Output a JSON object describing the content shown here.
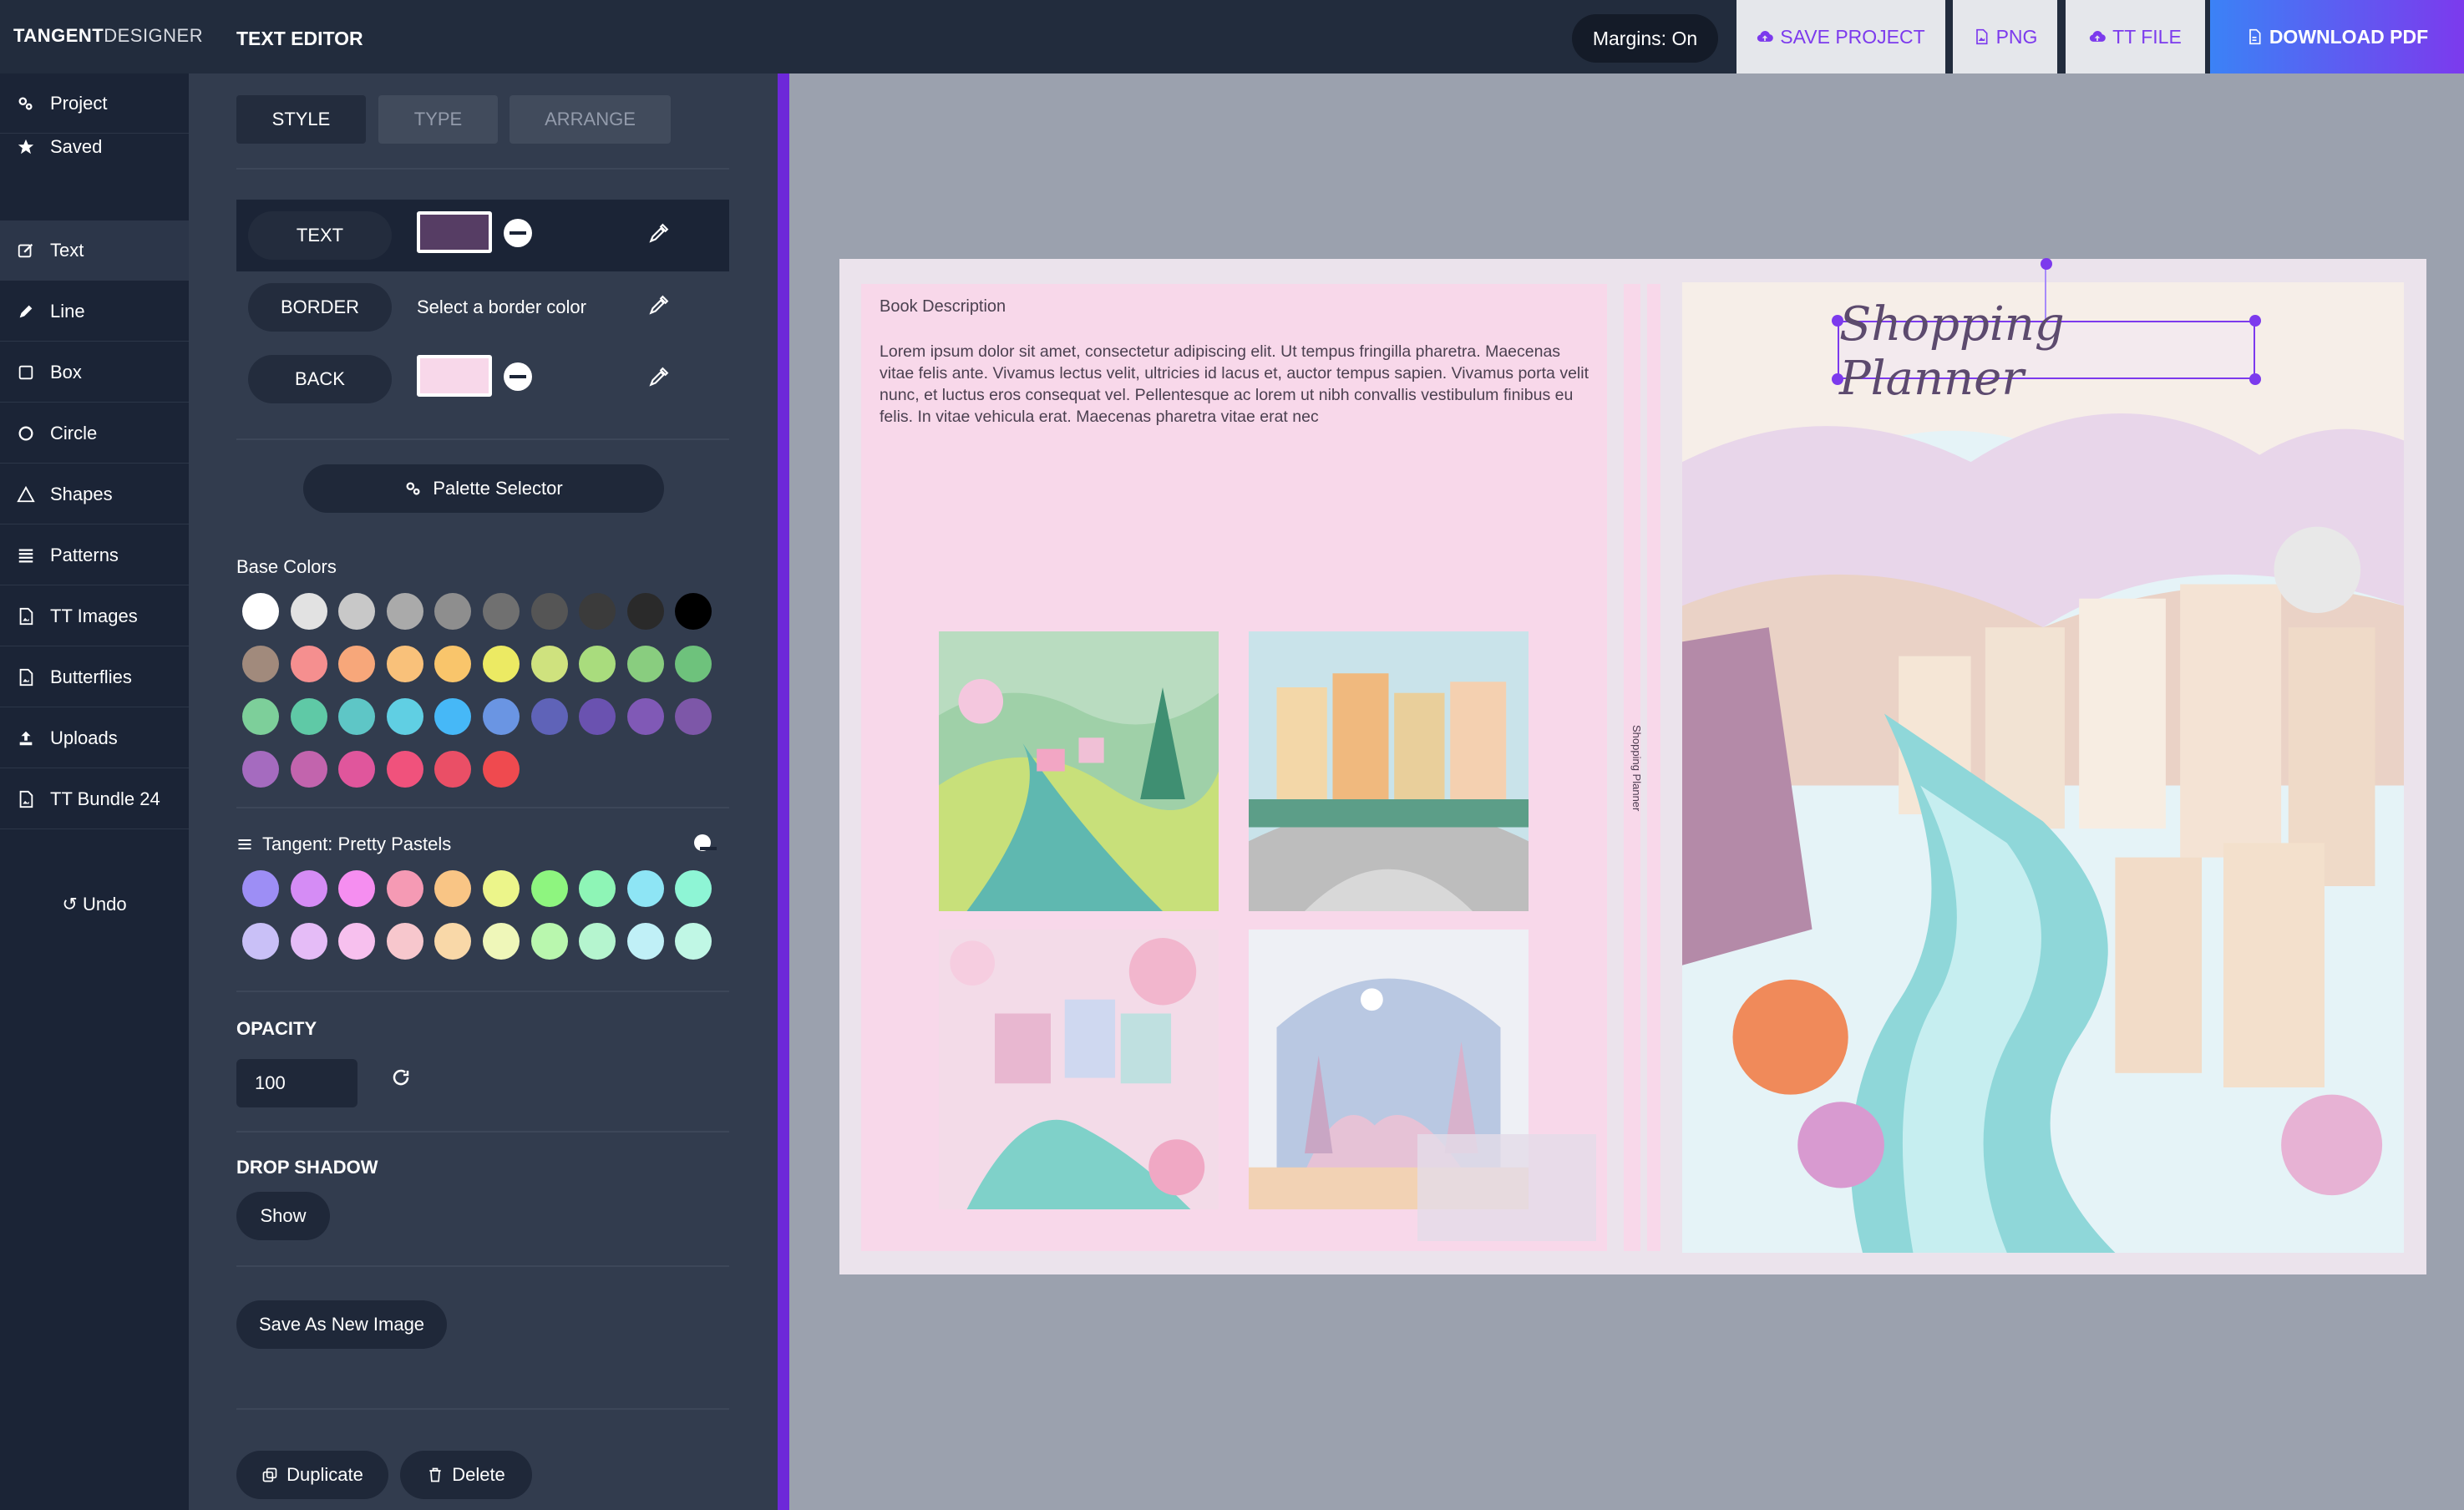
{
  "topbar": {
    "brand_bold": "TANGENT",
    "brand_light": "DESIGNER",
    "editor_title": "TEXT EDITOR",
    "margins": "Margins: On",
    "save_project": "SAVE PROJECT",
    "png": "PNG",
    "tt_file": "TT FILE",
    "download_pdf": "DOWNLOAD PDF"
  },
  "nav": {
    "items": [
      {
        "label": "Project",
        "icon": "gears-icon"
      },
      {
        "label": "Saved",
        "icon": "star-icon"
      },
      {
        "label": "Text",
        "icon": "edit-icon"
      },
      {
        "label": "Line",
        "icon": "pen-icon"
      },
      {
        "label": "Box",
        "icon": "square-icon"
      },
      {
        "label": "Circle",
        "icon": "circle-icon"
      },
      {
        "label": "Shapes",
        "icon": "triangle-icon"
      },
      {
        "label": "Patterns",
        "icon": "list-icon"
      },
      {
        "label": "TT Images",
        "icon": "file-image-icon"
      },
      {
        "label": "Butterflies",
        "icon": "file-image-icon"
      },
      {
        "label": "Uploads",
        "icon": "upload-icon"
      },
      {
        "label": "TT Bundle 24",
        "icon": "file-image-icon"
      }
    ],
    "undo": "Undo"
  },
  "panel": {
    "tabs": [
      "STYLE",
      "TYPE",
      "ARRANGE"
    ],
    "text_label": "TEXT",
    "text_color": "#563d64",
    "border_label": "BORDER",
    "border_placeholder": "Select a border color",
    "back_label": "BACK",
    "back_color": "#f8d8ea",
    "palette_selector": "Palette Selector",
    "base_colors_label": "Base Colors",
    "base_colors": [
      "#ffffff",
      "#e2e2e2",
      "#c8c8c8",
      "#aaaaaa",
      "#8e8e8e",
      "#707070",
      "#555555",
      "#3b3b3b",
      "#2a2a2a",
      "#000000",
      "#a18a7c",
      "#f58f8f",
      "#f7a77a",
      "#f9c17a",
      "#f9c56b",
      "#ecea63",
      "#cfe27e",
      "#a9dc7d",
      "#89cd7f",
      "#6ec27c",
      "#7dcf9a",
      "#5fc9a6",
      "#5ec6c6",
      "#60cfe3",
      "#46b8f7",
      "#6a95e3",
      "#5f63b8",
      "#6a52b0",
      "#8059b6",
      "#7d57a8",
      "#a56bbf",
      "#c264ad",
      "#e0569c",
      "#f0527c",
      "#ea4f66",
      "#ef4a4f"
    ],
    "palette_name": "Tangent: Pretty Pastels",
    "palette_colors": [
      "#9d8ef5",
      "#d58cf5",
      "#f58ef0",
      "#f59ab4",
      "#f9c585",
      "#ecf58a",
      "#8ef57f",
      "#8ef5b6",
      "#8ee5f5",
      "#8ef5d5",
      "#c9c0f7",
      "#e5bcf7",
      "#f7c0ee",
      "#f7c7cd",
      "#f9d8a8",
      "#eff7b9",
      "#b9f7ae",
      "#b5f5cf",
      "#c0f0f7",
      "#c0f7e5"
    ],
    "opacity_label": "OPACITY",
    "opacity_value": "100",
    "drop_shadow_label": "DROP SHADOW",
    "show": "Show",
    "save_as_new": "Save As New Image",
    "duplicate": "Duplicate",
    "delete": "Delete"
  },
  "canvas": {
    "back_title": "Book Description",
    "back_body": "Lorem ipsum dolor sit amet, consectetur adipiscing elit. Ut tempus fringilla pharetra. Maecenas vitae felis ante. Vivamus lectus velit, ultricies id lacus et, auctor tempus sapien. Vivamus porta velit nunc, et luctus eros consequat vel. Pellentesque ac lorem ut nibh convallis vestibulum finibus eu felis. In vitae vehicula erat. Maecenas pharetra vitae erat nec",
    "spine_text": "Shopping Planner",
    "cover_title": "Shopping Planner"
  }
}
